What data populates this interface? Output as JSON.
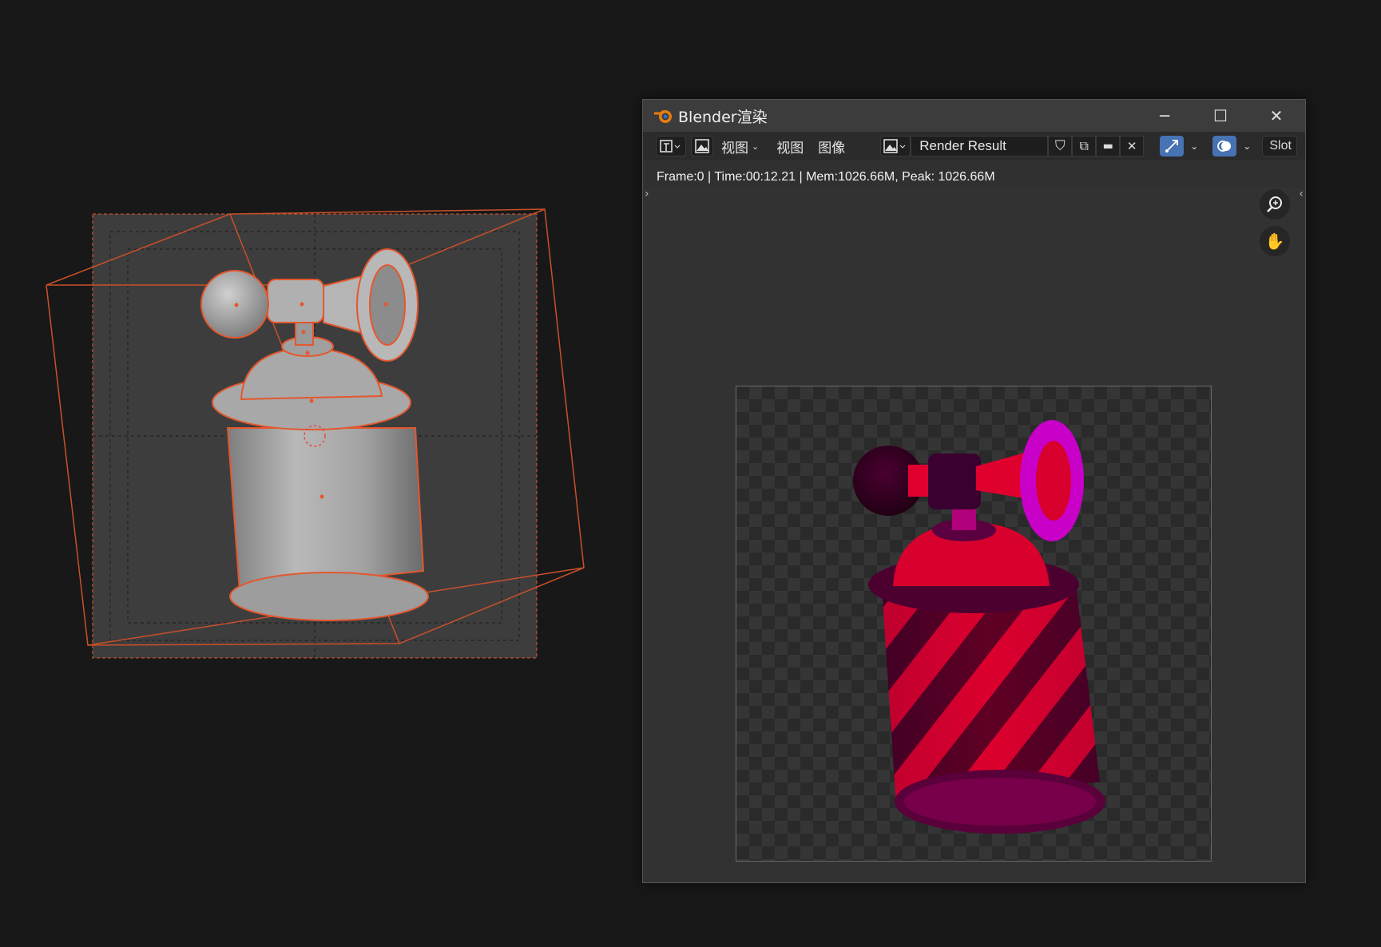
{
  "render_window": {
    "title": "Blender渲染",
    "controls": {
      "minimize": "─",
      "maximize": "☐",
      "close": "✕"
    },
    "toolbar": {
      "menus": [
        "视图",
        "视图",
        "图像"
      ],
      "image_name": "Render Result",
      "slot_label": "Slot"
    },
    "status": "Frame:0 | Time:00:12.21 | Mem:1026.66M, Peak: 1026.66M",
    "gizmo_icons": [
      "zoom-icon",
      "pan-hand-icon"
    ]
  },
  "colors": {
    "background": "#181818",
    "selection_outline": "#e4572e",
    "accent_blue": "#4772b3",
    "render_red": "#d8002c",
    "render_dark": "#3a0020",
    "render_magenta": "#c400c8"
  }
}
